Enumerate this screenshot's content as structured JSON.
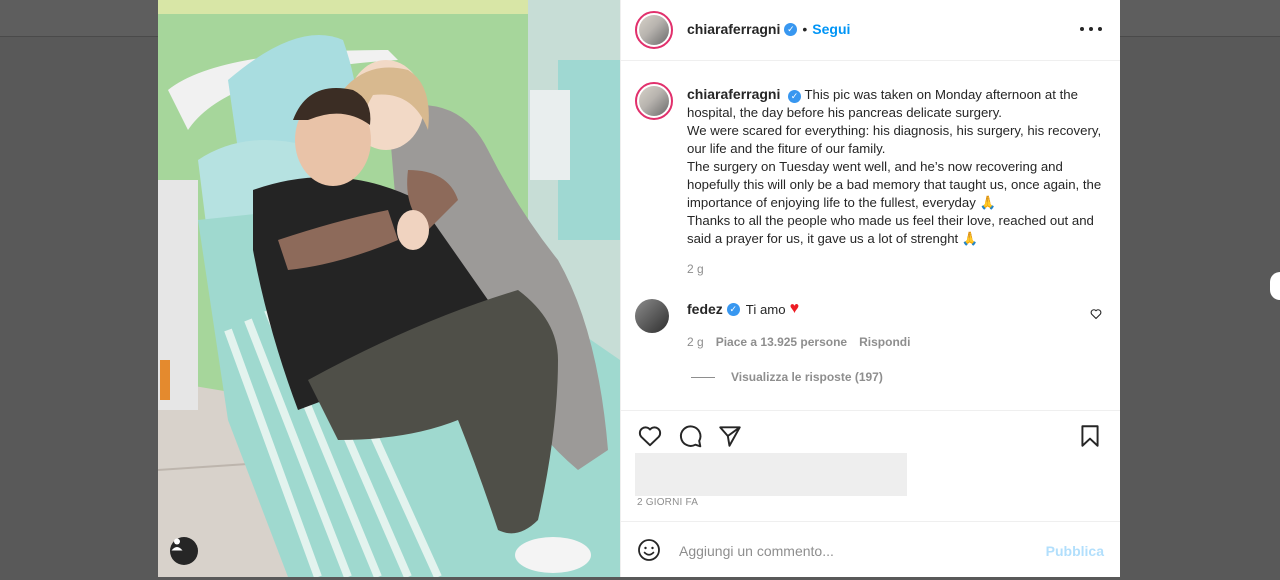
{
  "post": {
    "author": "chiaraferragni",
    "follow_label": "Segui",
    "dot": "•",
    "verified_glyph": "✓",
    "caption": {
      "author": "chiaraferragni",
      "lines": [
        "This pic was taken on Monday afternoon at the hospital, the day before his pancreas delicate surgery.",
        "We were scared for everything: his diagnosis, his surgery, his recovery, our life and the fiture of our family.",
        "The surgery on Tuesday went well, and he’s now recovering and hopefully this will only be a bad memory that taught us, once again, the importance of enjoying life to the fullest, everyday 🙏",
        "Thanks to all the people who made us feel their love, reached out and said a prayer for us, it gave us a lot of strenght 🙏"
      ],
      "age": "2 g"
    },
    "comments": [
      {
        "author": "fedez",
        "text": "Ti amo",
        "emoji": "♥",
        "age": "2 g",
        "likes": "Piace a 13.925 persone",
        "reply_label": "Rispondi",
        "view_replies": "Visualizza le risposte (197)"
      }
    ],
    "date": "2 GIORNI FA",
    "comment_box": {
      "placeholder": "Aggiungi un commento...",
      "publish_label": "Pubblica"
    },
    "icons": {
      "like": "heart-icon",
      "comment": "comment-icon",
      "share": "send-icon",
      "save": "bookmark-icon",
      "options": "more-horizontal-icon",
      "emoji": "emoji-icon",
      "tag": "user-tag-icon"
    },
    "colors": {
      "accent": "#0095f6",
      "verified": "#3897f0",
      "publish_disabled": "#b2dffc",
      "muted": "#8e8e8e"
    }
  }
}
